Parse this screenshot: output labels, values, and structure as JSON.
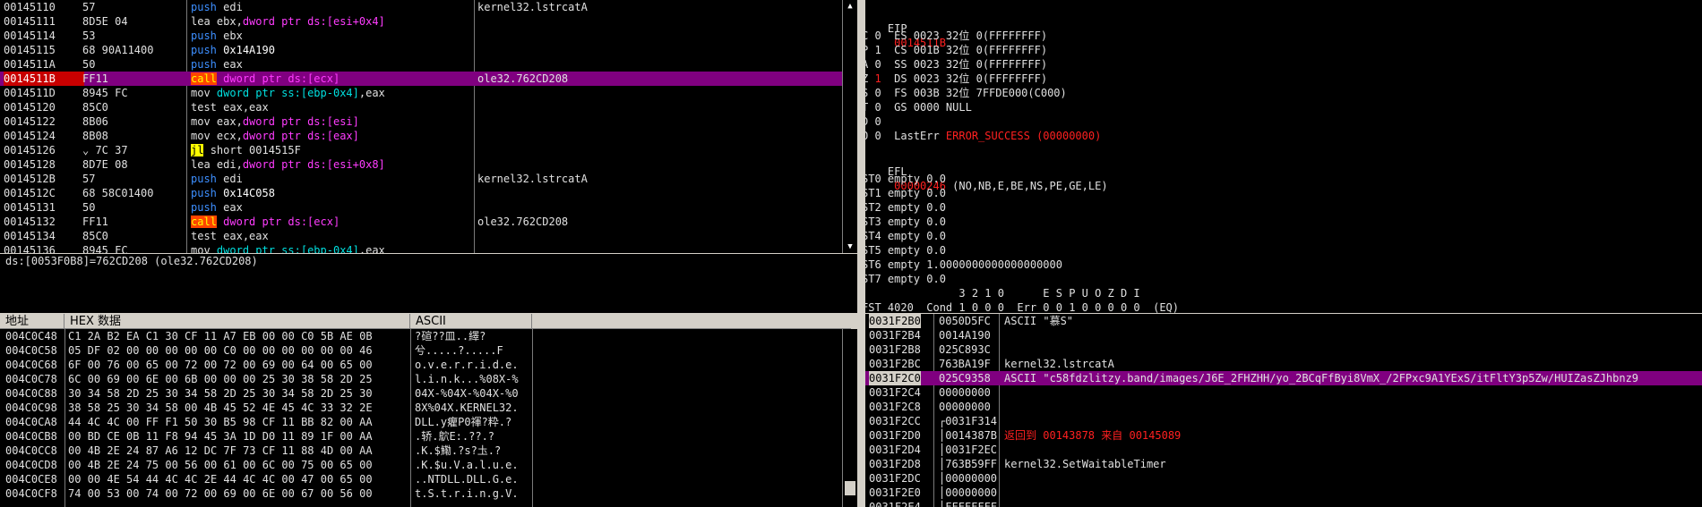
{
  "disasm": {
    "rows": [
      {
        "addr": "00145110",
        "hex": "57",
        "mn": "push",
        "ops": [
          [
            "op-reg",
            "edi"
          ]
        ],
        "cmt": "kernel32.lstrcatA"
      },
      {
        "addr": "00145111",
        "hex": "8D5E 04",
        "mn": "lea",
        "ops": [
          [
            "op-reg",
            "ebx,"
          ],
          [
            "op-mem",
            "dword ptr ds:[esi+0x4]"
          ]
        ],
        "cmt": ""
      },
      {
        "addr": "00145114",
        "hex": "53",
        "mn": "push",
        "ops": [
          [
            "op-reg",
            "ebx"
          ]
        ],
        "cmt": ""
      },
      {
        "addr": "00145115",
        "hex": "68 90A11400",
        "mn": "push",
        "ops": [
          [
            "op-imm",
            "0x14A190"
          ]
        ],
        "cmt": ""
      },
      {
        "addr": "0014511A",
        "hex": "50",
        "mn": "push",
        "ops": [
          [
            "op-reg",
            "eax"
          ]
        ],
        "cmt": ""
      },
      {
        "addr": "0014511B",
        "hex": "FF11",
        "mn": "call",
        "ops": [
          [
            "op-mem",
            "dword ptr ds:[ecx]"
          ]
        ],
        "cmt": "ole32.762CD208",
        "selected": true
      },
      {
        "addr": "0014511D",
        "hex": "8945 FC",
        "mn": "mov",
        "ops": [
          [
            "op-mem2",
            "dword ptr ss:[ebp-0x4]"
          ],
          [
            "op-reg",
            ",eax"
          ]
        ],
        "cmt": ""
      },
      {
        "addr": "00145120",
        "hex": "85C0",
        "mn": "test",
        "ops": [
          [
            "op-reg",
            "eax,eax"
          ]
        ],
        "cmt": ""
      },
      {
        "addr": "00145122",
        "hex": "8B06",
        "mn": "mov",
        "ops": [
          [
            "op-reg",
            "eax,"
          ],
          [
            "op-mem",
            "dword ptr ds:[esi]"
          ]
        ],
        "cmt": ""
      },
      {
        "addr": "00145124",
        "hex": "8B08",
        "mn": "mov",
        "ops": [
          [
            "op-reg",
            "ecx,"
          ],
          [
            "op-mem",
            "dword ptr ds:[eax]"
          ]
        ],
        "cmt": ""
      },
      {
        "addr": "00145126",
        "hex": "⌄ 7C 37",
        "mn": "jl",
        "ops": [
          [
            "op-reg",
            "short 0014515F"
          ]
        ],
        "cmt": ""
      },
      {
        "addr": "00145128",
        "hex": "8D7E 08",
        "mn": "lea",
        "ops": [
          [
            "op-reg",
            "edi,"
          ],
          [
            "op-mem",
            "dword ptr ds:[esi+0x8]"
          ]
        ],
        "cmt": ""
      },
      {
        "addr": "0014512B",
        "hex": "57",
        "mn": "push",
        "ops": [
          [
            "op-reg",
            "edi"
          ]
        ],
        "cmt": "kernel32.lstrcatA"
      },
      {
        "addr": "0014512C",
        "hex": "68 58C01400",
        "mn": "push",
        "ops": [
          [
            "op-imm",
            "0x14C058"
          ]
        ],
        "cmt": ""
      },
      {
        "addr": "00145131",
        "hex": "50",
        "mn": "push",
        "ops": [
          [
            "op-reg",
            "eax"
          ]
        ],
        "cmt": ""
      },
      {
        "addr": "00145132",
        "hex": "FF11",
        "mn": "call",
        "ops": [
          [
            "op-mem",
            "dword ptr ds:[ecx]"
          ]
        ],
        "cmt": "ole32.762CD208"
      },
      {
        "addr": "00145134",
        "hex": "85C0",
        "mn": "test",
        "ops": [
          [
            "op-reg",
            "eax,eax"
          ]
        ],
        "cmt": ""
      },
      {
        "addr": "00145136",
        "hex": "8945 FC",
        "mn": "mov",
        "ops": [
          [
            "op-mem2",
            "dword ptr ss:[ebp-0x4]"
          ],
          [
            "op-reg",
            ",eax"
          ]
        ],
        "cmt": ""
      }
    ]
  },
  "info": {
    "line1": "ds:[0053F0B8]=762CD208 (ole32.762CD208)"
  },
  "registers": {
    "eip_label": "EIP",
    "eip_value": "0014511B",
    "flags": [
      {
        "pre": "C 0  ES 0023 32位 0(FFFFFFFF)"
      },
      {
        "pre": "P 1  CS 001B 32位 0(FFFFFFFF)"
      },
      {
        "pre": "A 0  SS 0023 32位 0(FFFFFFFF)"
      },
      {
        "pre": "Z ",
        "red": "1",
        "post": "  DS 0023 32位 0(FFFFFFFF)"
      },
      {
        "pre": "S 0  FS 003B 32位 7FFDE000(C000)"
      },
      {
        "pre": "T 0  GS 0000 NULL"
      },
      {
        "pre": "D 0"
      },
      {
        "pre": "O 0  LastErr ",
        "red": "ERROR_SUCCESS (00000000)"
      }
    ],
    "efl_label": "EFL",
    "efl_value": "00000246",
    "efl_desc": " (NO,NB,E,BE,NS,PE,GE,LE)",
    "fpu": [
      "ST0 empty 0.0",
      "ST1 empty 0.0",
      "ST2 empty 0.0",
      "ST3 empty 0.0",
      "ST4 empty 0.0",
      "ST5 empty 0.0",
      "ST6 empty 1.0000000000000000000",
      "ST7 empty 0.0"
    ],
    "fpu_header": "               3 2 1 0      E S P U O Z D I",
    "fst_line": "FST 4020  Cond 1 0 0 0  Err 0 0 1 0 0 0 0 0  (EQ)"
  },
  "dump": {
    "headers": {
      "addr": "地址",
      "hex": "HEX 数据",
      "ascii": "ASCII"
    },
    "rows": [
      {
        "addr": "004C0C48",
        "hex": "C1 2A B2 EA C1 30 CF 11 A7 EB 00 00 C0 5B AE 0B",
        "asc": "?碹??皿..繹?"
      },
      {
        "addr": "004C0C58",
        "hex": "05 DF 02 00 00 00 00 00 C0 00 00 00 00 00 00 46",
        "asc": "兮.....?.....F"
      },
      {
        "addr": "004C0C68",
        "hex": "6F 00 76 00 65 00 72 00 72 00 69 00 64 00 65 00",
        "asc": "o.v.e.r.r.i.d.e."
      },
      {
        "addr": "004C0C78",
        "hex": "6C 00 69 00 6E 00 6B 00 00 00 25 30 38 58 2D 25",
        "asc": "l.i.n.k...%08X-%"
      },
      {
        "addr": "004C0C88",
        "hex": "30 34 58 2D 25 30 34 58 2D 25 30 34 58 2D 25 30",
        "asc": "04X-%04X-%04X-%0"
      },
      {
        "addr": "004C0C98",
        "hex": "38 58 25 30 34 58 00 4B 45 52 4E 45 4C 33 32 2E",
        "asc": "8X%04X.KERNEL32."
      },
      {
        "addr": "004C0CA8",
        "hex": "44 4C 4C 00 FF F1 50 30 B5 98 CF 11 BB 82 00 AA",
        "asc": "DLL.y癯P0禈?粋.?"
      },
      {
        "addr": "004C0CB8",
        "hex": "00 BD CE 0B 11 F8 94 45 3A 1D D0 11 89 1F 00 AA",
        "asc": ".轿.鴥E:.??.?"
      },
      {
        "addr": "004C0CC8",
        "hex": "00 4B 2E 24 87 A6 12 DC 7F 73 CF 11 88 4D 00 AA",
        "asc": ".K.$鰳.?s?圡.?"
      },
      {
        "addr": "004C0CD8",
        "hex": "00 4B 2E 24 75 00 56 00 61 00 6C 00 75 00 65 00",
        "asc": ".K.$u.V.a.l.u.e."
      },
      {
        "addr": "004C0CE8",
        "hex": "00 00 4E 54 44 4C 4C 2E 44 4C 4C 00 47 00 65 00",
        "asc": "..NTDLL.DLL.G.e."
      },
      {
        "addr": "004C0CF8",
        "hex": "74 00 53 00 74 00 72 00 69 00 6E 00 67 00 56 00",
        "asc": "t.S.t.r.i.n.g.V."
      }
    ]
  },
  "stack": {
    "rows": [
      {
        "addr": "0031F2B0",
        "val": "0050D5FC",
        "cmt": "ASCII \"慕S\"",
        "top": true
      },
      {
        "addr": "0031F2B4",
        "val": "0014A190",
        "cmt": ""
      },
      {
        "addr": "0031F2B8",
        "val": "025C893C",
        "cmt": ""
      },
      {
        "addr": "0031F2BC",
        "val": "763BA19F",
        "cmt": "kernel32.lstrcatA"
      },
      {
        "addr": "0031F2C0",
        "val": "025C9358",
        "cmt": "ASCII \"c58fdzlitzy.band/images/J6E_2FHZHH/yo_2BCqFfByi8VmX_/2FPxc9A1YExS/itFltY3p5Zw/HUIZasZJhbnz9",
        "selected": true
      },
      {
        "addr": "0031F2C4",
        "val": "00000000",
        "cmt": ""
      },
      {
        "addr": "0031F2C8",
        "val": "00000000",
        "cmt": ""
      },
      {
        "addr": "0031F2CC",
        "val": "┌0031F314",
        "cmt": ""
      },
      {
        "addr": "0031F2D0",
        "val": "│0014387B",
        "cmt": "返回到 00143878 来自 00145089",
        "red": true
      },
      {
        "addr": "0031F2D4",
        "val": "│0031F2EC",
        "cmt": ""
      },
      {
        "addr": "0031F2D8",
        "val": "│763B59FF",
        "cmt": "kernel32.SetWaitableTimer"
      },
      {
        "addr": "0031F2DC",
        "val": "│00000000",
        "cmt": ""
      },
      {
        "addr": "0031F2E0",
        "val": "│00000000",
        "cmt": ""
      },
      {
        "addr": "0031F2E4",
        "val": "│FFFFFFFF",
        "cmt": ""
      }
    ]
  }
}
